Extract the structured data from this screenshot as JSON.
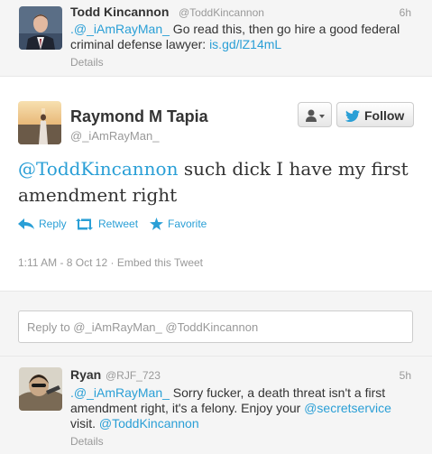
{
  "top_tweet": {
    "name": "Todd Kincannon",
    "handle": "@ToddKincannon",
    "time": "6h",
    "mention": ".@_iAmRayMan_",
    "text": " Go read this, then go hire a good federal criminal defense lawyer: ",
    "link": "is.gd/lZ14mL",
    "details": "Details"
  },
  "main_tweet": {
    "name": "Raymond M Tapia",
    "handle": "@_iAmRayMan_",
    "mention": "@ToddKincannon",
    "text": " such dick I have my first amendment right",
    "actions": {
      "reply": "Reply",
      "retweet": "Retweet",
      "favorite": "Favorite"
    },
    "timestamp": "1:11 AM - 8 Oct 12",
    "separator": " · ",
    "embed": "Embed this Tweet",
    "follow_label": "Follow"
  },
  "reply_box": {
    "placeholder": "Reply to @_iAmRayMan_ @ToddKincannon"
  },
  "bottom_tweet": {
    "name": "Ryan",
    "handle": "@RJF_723",
    "time": "5h",
    "mention": ".@_iAmRayMan_",
    "text1": " Sorry fucker, a death threat isn't a first amendment right, it's a felony. Enjoy your ",
    "mention2": "@secretservice",
    "text2": " visit. ",
    "mention3": "@ToddKincannon",
    "details": "Details"
  },
  "colors": {
    "link": "#2a9fd6",
    "muted": "#999999",
    "text": "#333333",
    "background_alt": "#f5f5f5"
  },
  "icons": [
    "reply-arrow-icon",
    "retweet-icon",
    "star-icon",
    "person-icon",
    "twitter-bird-icon",
    "caret-down-icon"
  ]
}
